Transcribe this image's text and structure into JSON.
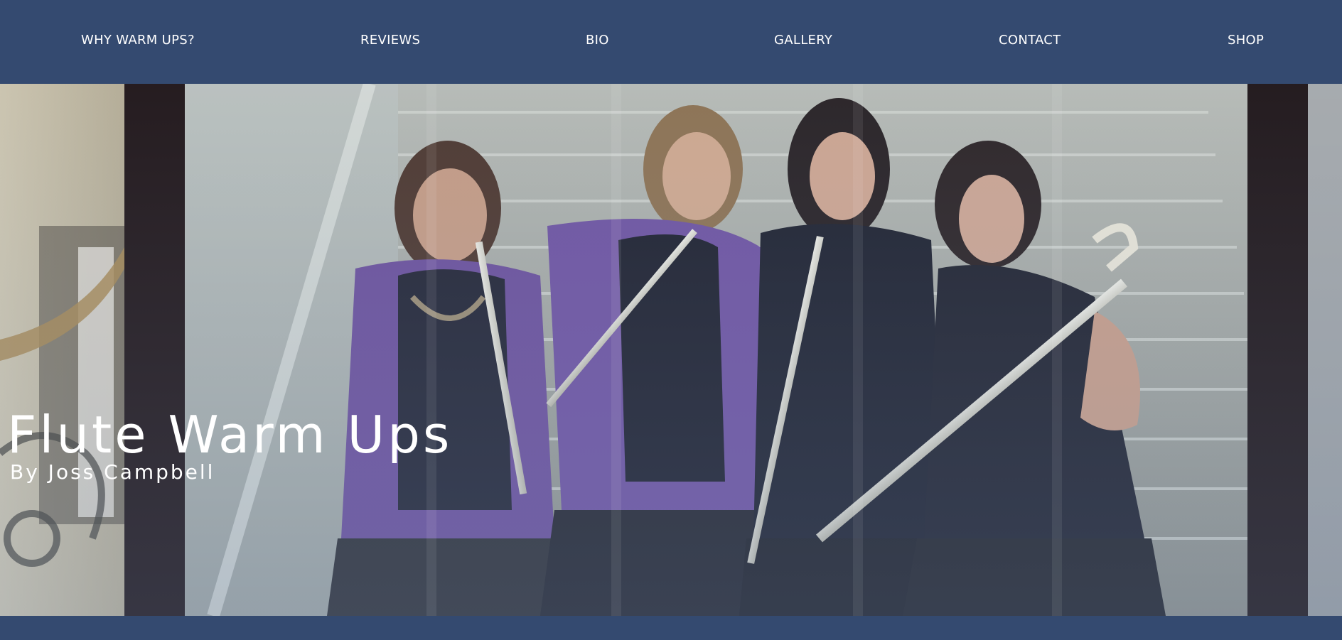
{
  "nav": {
    "items": [
      {
        "label": "WHY WARM UPS?"
      },
      {
        "label": "REVIEWS"
      },
      {
        "label": "BIO"
      },
      {
        "label": "GALLERY"
      },
      {
        "label": "CONTACT"
      },
      {
        "label": "SHOP"
      }
    ]
  },
  "hero": {
    "title": "Flute Warm Ups",
    "subtitle": "By Joss Campbell"
  },
  "colors": {
    "nav_background": "#344a70",
    "text": "#ffffff"
  }
}
